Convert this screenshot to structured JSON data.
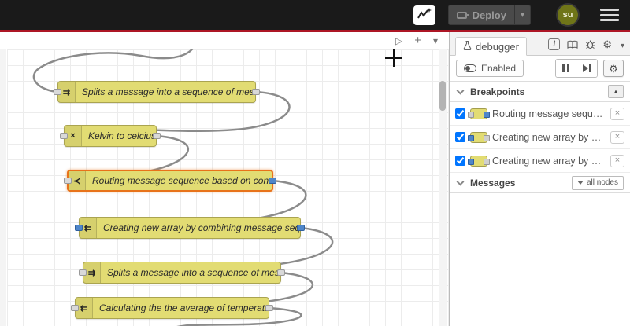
{
  "colors": {
    "accent_red": "#ad1625",
    "node_fill": "#e2dc73",
    "node_selected_border": "#e8731a",
    "port_blue": "#4f86c9",
    "avatar_bg": "#6f7518"
  },
  "header": {
    "deploy_label": "Deploy",
    "deploy_caret": "▾",
    "avatar_text": "su"
  },
  "workspace_toolbar": {
    "play_glyph": "▷",
    "add_glyph": "+",
    "collapse_glyph": "▾"
  },
  "canvas": {
    "nodes": [
      {
        "label": "Splits a message into a sequence of messages.",
        "icon": "⇉"
      },
      {
        "label": "Kelvin to celcius",
        "icon": "×"
      },
      {
        "label": "Routing message sequence based on condition",
        "icon": "≺"
      },
      {
        "label": "Creating new array by combining message sequence",
        "icon": "⇇"
      },
      {
        "label": "Splits a message into a sequence of messages.",
        "icon": "⇉"
      },
      {
        "label": "Calculating the the average of temperature",
        "icon": "⇇"
      }
    ]
  },
  "sidebar": {
    "tab_label": "debugger",
    "info_glyph": "i",
    "gear_glyph": "⚙",
    "collapse_glyph": "▾",
    "enabled_label": "Enabled",
    "breakpoints": {
      "title": "Breakpoints",
      "action_glyph": "▴",
      "remove_glyph": "×",
      "items": [
        {
          "label": "Routing message sequence based on condition"
        },
        {
          "label": "Creating new array by combining message sequence"
        },
        {
          "label": "Creating new array by combining message sequence"
        }
      ]
    },
    "messages": {
      "title": "Messages",
      "filter_label": "all nodes"
    }
  }
}
